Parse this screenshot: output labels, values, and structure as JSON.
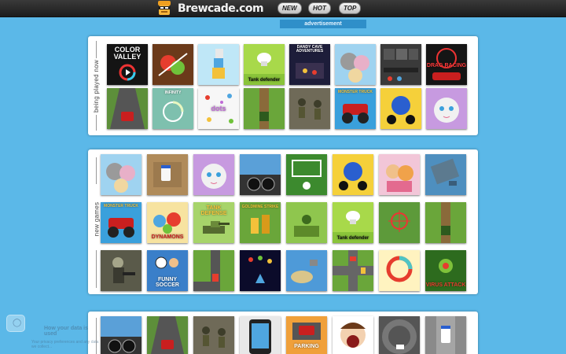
{
  "site": {
    "name": "Brewcade.com"
  },
  "nav": {
    "new_label": "NEW",
    "hot_label": "HOT",
    "top_label": "TOP"
  },
  "ad": {
    "label": "advertisement"
  },
  "sections": [
    {
      "label": "being played now",
      "tiles": [
        {
          "name": "color-valley",
          "caption": "COLOR VALLEY"
        },
        {
          "name": "fruit-slice",
          "caption": ""
        },
        {
          "name": "tower-blocks",
          "caption": ""
        },
        {
          "name": "tank-defender",
          "caption": "Tank defender"
        },
        {
          "name": "dandy-cave-adventures",
          "caption": "DANDY CAVE ADVENTURES"
        },
        {
          "name": "talking-cat-family",
          "caption": ""
        },
        {
          "name": "block-puzzle",
          "caption": ""
        },
        {
          "name": "drag-racing",
          "caption": "DRAG RACING"
        },
        {
          "name": "highway-racer",
          "caption": ""
        },
        {
          "name": "infinity-circle",
          "caption": "INFINITY"
        },
        {
          "name": "dots-game",
          "caption": "dots"
        },
        {
          "name": "tank-field",
          "caption": ""
        },
        {
          "name": "soldiers",
          "caption": ""
        },
        {
          "name": "monster-truck",
          "caption": "MONSTER TRUCK"
        },
        {
          "name": "moto-rider",
          "caption": ""
        },
        {
          "name": "angela-cat",
          "caption": ""
        }
      ]
    },
    {
      "label": "new games",
      "tiles": [
        {
          "name": "talking-cat-family",
          "caption": ""
        },
        {
          "name": "police-cars",
          "caption": ""
        },
        {
          "name": "angela-cat",
          "caption": ""
        },
        {
          "name": "car-dashboard",
          "caption": ""
        },
        {
          "name": "soccer-goal",
          "caption": ""
        },
        {
          "name": "moto-rider",
          "caption": ""
        },
        {
          "name": "kids-dressup",
          "caption": ""
        },
        {
          "name": "rooftop",
          "caption": ""
        },
        {
          "name": "monster-truck",
          "caption": "MONSTER TRUCK"
        },
        {
          "name": "dynamons",
          "caption": "DYNAMONS"
        },
        {
          "name": "tank-defense",
          "caption": "TANK DEFENSE"
        },
        {
          "name": "goldmine-strike",
          "caption": "GOLDMINE STRIKE"
        },
        {
          "name": "army-men",
          "caption": ""
        },
        {
          "name": "tank-defender",
          "caption": "Tank defender"
        },
        {
          "name": "sniper-field",
          "caption": ""
        },
        {
          "name": "tank-field",
          "caption": ""
        },
        {
          "name": "zombie-shooter",
          "caption": ""
        },
        {
          "name": "funny-soccer",
          "caption": "FUNNY SOCCER"
        },
        {
          "name": "road-turn",
          "caption": ""
        },
        {
          "name": "space-shooter",
          "caption": ""
        },
        {
          "name": "island-war",
          "caption": ""
        },
        {
          "name": "traffic-control",
          "caption": ""
        },
        {
          "name": "color-circle",
          "caption": ""
        },
        {
          "name": "virus-attack",
          "caption": "VIRUS ATTACK"
        }
      ]
    },
    {
      "label": "",
      "tiles": [
        {
          "name": "car-dashboard",
          "caption": ""
        },
        {
          "name": "highway-racer",
          "caption": ""
        },
        {
          "name": "soldiers",
          "caption": ""
        },
        {
          "name": "phone-screen",
          "caption": ""
        },
        {
          "name": "car-parking",
          "caption": "PARKING"
        },
        {
          "name": "dentist-girl",
          "caption": ""
        },
        {
          "name": "drift-car",
          "caption": ""
        },
        {
          "name": "police-topdown",
          "caption": ""
        }
      ]
    }
  ],
  "cookie": {
    "title": "How your data is used",
    "text": "Your privacy preferences and any data we collect..."
  },
  "colors": {
    "background": "#5bb8e8",
    "topbar": "#2a2a2a",
    "ad": "#2f8fc9",
    "panel": "#ffffff"
  }
}
